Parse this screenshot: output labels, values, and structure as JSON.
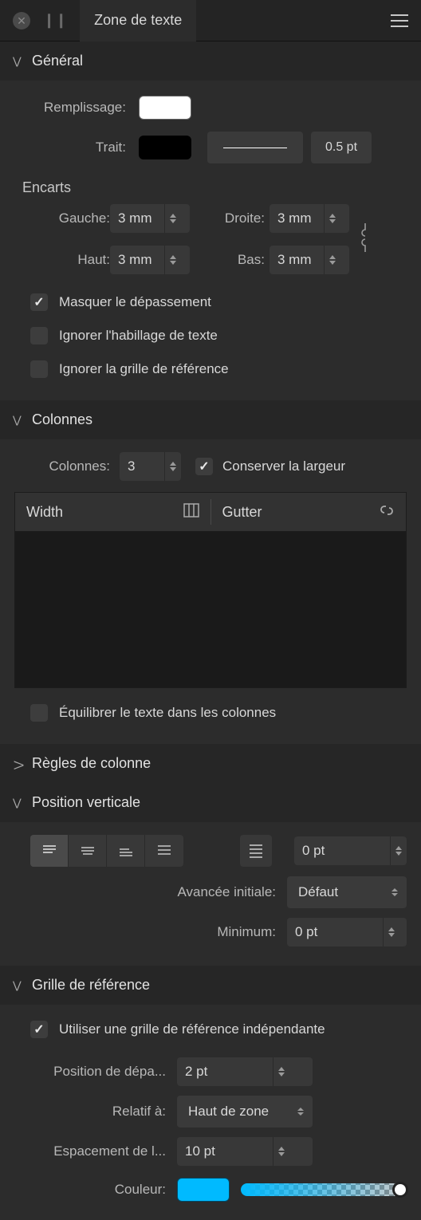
{
  "titlebar": {
    "title": "Zone de texte"
  },
  "general": {
    "title": "Général",
    "fill_label": "Remplissage:",
    "fill_color": "#ffffff",
    "stroke_label": "Trait:",
    "stroke_color": "#000000",
    "stroke_weight": "0.5 pt",
    "insets": {
      "title": "Encarts",
      "left_label": "Gauche:",
      "left": "3 mm",
      "right_label": "Droite:",
      "right": "3 mm",
      "top_label": "Haut:",
      "top": "3 mm",
      "bottom_label": "Bas:",
      "bottom": "3 mm"
    },
    "hide_overflow": {
      "label": "Masquer le dépassement",
      "checked": true
    },
    "ignore_wrap": {
      "label": "Ignorer l'habillage de texte",
      "checked": false
    },
    "ignore_grid": {
      "label": "Ignorer la grille de référence",
      "checked": false
    }
  },
  "columns": {
    "title": "Colonnes",
    "count_label": "Colonnes:",
    "count": "3",
    "fixed_width": {
      "label": "Conserver la largeur",
      "checked": true
    },
    "table": {
      "width_header": "Width",
      "gutter_header": "Gutter"
    },
    "balance": {
      "label": "Équilibrer le texte dans les colonnes",
      "checked": false
    }
  },
  "column_rules": {
    "title": "Règles de colonne"
  },
  "vertical": {
    "title": "Position verticale",
    "offset": "0 pt",
    "initial_label": "Avancée initiale:",
    "initial_value": "Défaut",
    "minimum_label": "Minimum:",
    "minimum_value": "0 pt"
  },
  "basegrid": {
    "title": "Grille de référence",
    "use_independent": {
      "label": "Utiliser une grille de référence indépendante",
      "checked": true
    },
    "start_label": "Position de dépa...",
    "start_value": "2 pt",
    "relative_label": "Relatif à:",
    "relative_value": "Haut de zone",
    "spacing_label": "Espacement de l...",
    "spacing_value": "10 pt",
    "color_label": "Couleur:",
    "color_value": "#00baff"
  }
}
